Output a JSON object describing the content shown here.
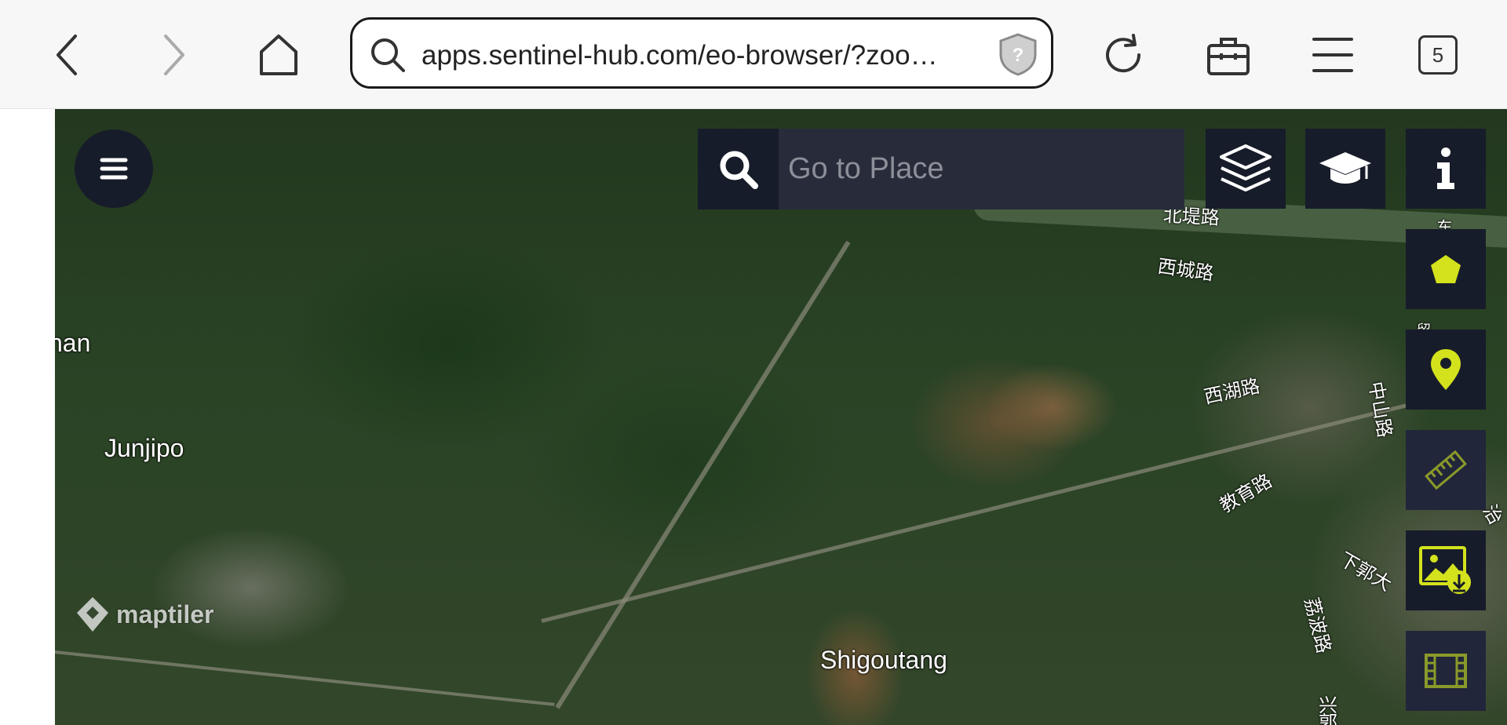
{
  "browser": {
    "url": "apps.sentinel-hub.com/eo-browser/?zoo…",
    "tab_count": "5",
    "icons": [
      "back-icon",
      "forward-icon",
      "home-icon",
      "search-icon",
      "shield-icon",
      "reload-icon",
      "toolbox-icon",
      "menu-icon",
      "tabs-icon"
    ]
  },
  "map": {
    "search_placeholder": "Go to Place",
    "attribution": "maptiler",
    "places": {
      "partial_left": "nan",
      "junjipo": "Junjipo",
      "shigoutang": "Shigoutang"
    },
    "streets": {
      "beidi": "北堤路",
      "xicheng": "西城路",
      "xihu": "西湖路",
      "zhongshan": "中山路",
      "jiaoyu": "教育路",
      "xiaguo": "下郭大",
      "libo": "荔波路",
      "dongdi": "东堤中路",
      "xing": "兴",
      "guo": "郭",
      "zhi": "治",
      "liu": "留"
    },
    "controls": [
      "menu-icon",
      "layers-icon",
      "education-icon",
      "info-icon",
      "pentagon-icon",
      "location-pin-icon",
      "ruler-icon",
      "image-download-icon",
      "film-icon"
    ]
  },
  "colors": {
    "accent": "#d3e21c",
    "panel": "#171c2a",
    "panel_input": "#282c3a"
  }
}
